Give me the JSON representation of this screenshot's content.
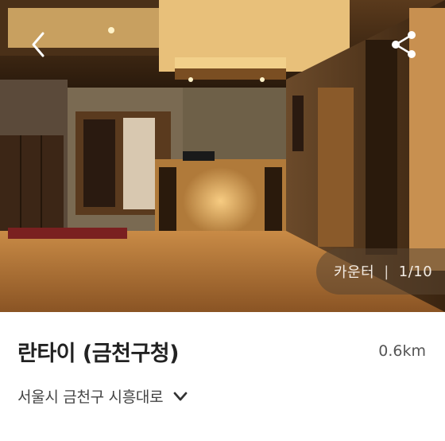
{
  "photo": {
    "category_label": "카운터",
    "separator": "|",
    "index": "1/10"
  },
  "header": {
    "back_icon": "chevron-left-icon",
    "share_icon": "share-icon"
  },
  "listing": {
    "name": "란타이 (금천구청)",
    "distance": "0.6km",
    "address": "서울시 금천구 시흥대로",
    "expand_icon": "chevron-down-icon"
  }
}
